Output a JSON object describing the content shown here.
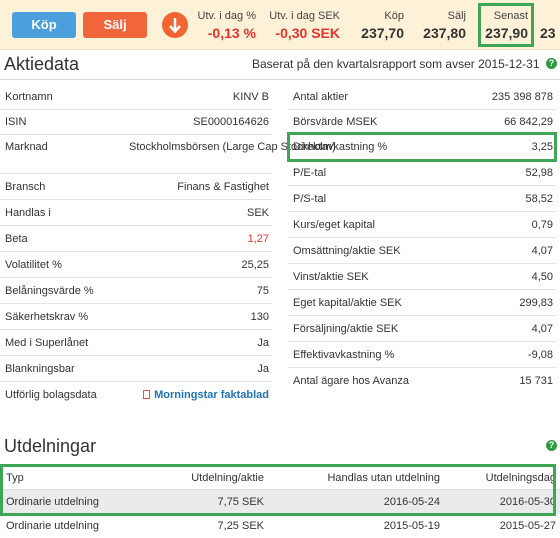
{
  "trade_bar": {
    "buy_label": "Köp",
    "sell_label": "Sälj",
    "change_pct_label": "Utv. i dag %",
    "change_pct_value": "-0,13 %",
    "change_sek_label": "Utv. i dag SEK",
    "change_sek_value": "-0,30 SEK",
    "bid_label": "Köp",
    "bid_value": "237,70",
    "ask_label": "Sälj",
    "ask_value": "237,80",
    "last_label": "Senast",
    "last_value": "237,90",
    "next_partial": "23",
    "arrow_icon": "arrow-down-icon"
  },
  "aktiedata": {
    "title": "Aktiedata",
    "source_note": "Baserat på den kvartalsrapport som avser 2015-12-31",
    "left": [
      {
        "label": "Kortnamn",
        "value": "KINV B"
      },
      {
        "label": "ISIN",
        "value": "SE0000164626"
      },
      {
        "label": "Marknad",
        "value": "Stockholmsbörsen (Large Cap Stockholm)"
      },
      {
        "label": "Bransch",
        "value": "Finans & Fastighet"
      },
      {
        "label": "Handlas i",
        "value": "SEK"
      },
      {
        "label": "Beta",
        "value": "1,27"
      },
      {
        "label": "Volatilitet %",
        "value": "25,25"
      },
      {
        "label": "Belåningsvärde %",
        "value": "75"
      },
      {
        "label": "Säkerhetskrav %",
        "value": "130"
      },
      {
        "label": "Med i Superlånet",
        "value": "Ja"
      },
      {
        "label": "Blankningsbar",
        "value": "Ja"
      },
      {
        "label": "Utförlig bolagsdata",
        "value": "Morningstar faktablad"
      }
    ],
    "right": [
      {
        "label": "Antal aktier",
        "value": "235 398 878"
      },
      {
        "label": "Börsvärde MSEK",
        "value": "66 842,29"
      },
      {
        "label": "Direktavkastning %",
        "value": "3,25"
      },
      {
        "label": "P/E-tal",
        "value": "52,98"
      },
      {
        "label": "P/S-tal",
        "value": "58,52"
      },
      {
        "label": "Kurs/eget kapital",
        "value": "0,79"
      },
      {
        "label": "Omsättning/aktie SEK",
        "value": "4,07"
      },
      {
        "label": "Vinst/aktie SEK",
        "value": "4,50"
      },
      {
        "label": "Eget kapital/aktie SEK",
        "value": "299,83"
      },
      {
        "label": "Försäljning/aktie SEK",
        "value": "4,07"
      },
      {
        "label": "Effektivavkastning %",
        "value": "-9,08"
      },
      {
        "label": "Antal ägare hos Avanza",
        "value": "15 731"
      }
    ]
  },
  "utdelningar": {
    "title": "Utdelningar",
    "headers": [
      "Typ",
      "Utdelning/aktie",
      "Handlas utan utdelning",
      "Utdelningsdag"
    ],
    "rows": [
      [
        "Ordinarie utdelning",
        "7,75 SEK",
        "2016-05-24",
        "2016-05-30"
      ],
      [
        "Ordinarie utdelning",
        "7,25 SEK",
        "2015-05-19",
        "2015-05-27"
      ]
    ]
  },
  "colors": {
    "buy": "#4a9fdc",
    "sell": "#f0663a",
    "negative": "#e8322b",
    "highlight": "#3ea655",
    "link": "#1f74b5"
  }
}
